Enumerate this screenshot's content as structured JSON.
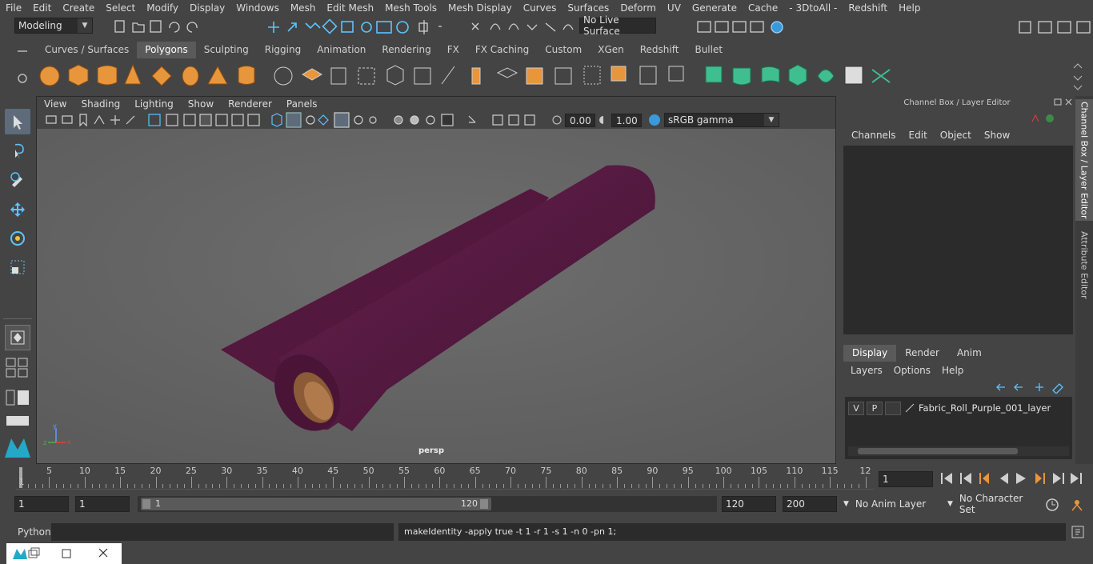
{
  "menubar": {
    "items": [
      "File",
      "Edit",
      "Create",
      "Select",
      "Modify",
      "Display",
      "Windows",
      "Mesh",
      "Edit Mesh",
      "Mesh Tools",
      "Mesh Display",
      "Curves",
      "Surfaces",
      "Deform",
      "UV",
      "Generate",
      "Cache",
      "- 3DtoAll -",
      "Redshift",
      "Help"
    ]
  },
  "statusline": {
    "mode": "Modeling",
    "live_surface": "No Live Surface"
  },
  "shelf": {
    "tabs": [
      "Curves / Surfaces",
      "Polygons",
      "Sculpting",
      "Rigging",
      "Animation",
      "Rendering",
      "FX",
      "FX Caching",
      "Custom",
      "XGen",
      "Redshift",
      "Bullet"
    ],
    "active_tab": "Polygons"
  },
  "panel": {
    "menu": [
      "View",
      "Shading",
      "Lighting",
      "Show",
      "Renderer",
      "Panels"
    ],
    "exposure": "0.00",
    "gamma": "1.00",
    "colorspace": "sRGB gamma",
    "camera_label": "persp"
  },
  "channelbox": {
    "title": "Channel Box / Layer Editor",
    "menu": [
      "Channels",
      "Edit",
      "Object",
      "Show"
    ]
  },
  "layereditor": {
    "tabs": [
      "Display",
      "Render",
      "Anim"
    ],
    "menu": [
      "Layers",
      "Options",
      "Help"
    ],
    "layers": [
      {
        "v": "V",
        "p": "P",
        "name": "Fabric_Roll_Purple_001_layer"
      }
    ]
  },
  "sidetabs": {
    "channel": "Channel Box / Layer Editor",
    "attribute": "Attribute Editor"
  },
  "timeline": {
    "ticks": [
      "5",
      "10",
      "15",
      "20",
      "25",
      "30",
      "35",
      "40",
      "45",
      "50",
      "55",
      "60",
      "65",
      "70",
      "75",
      "80",
      "85",
      "90",
      "95",
      "100",
      "105",
      "110",
      "115",
      "12"
    ],
    "start_marker": "1",
    "current_frame": "1"
  },
  "range": {
    "start": "1",
    "playback_start": "1",
    "slider_start": "1",
    "slider_end": "120",
    "playback_end": "120",
    "end": "200",
    "anim_layer": "No Anim Layer",
    "character_set": "No Character Set"
  },
  "cmdline": {
    "language": "Python",
    "result": "makeIdentity -apply true -t 1 -r 1 -s 1 -n 0 -pn 1;"
  },
  "colors": {
    "accent": "#5d6b7a",
    "fabric": "#5a1a43",
    "shelf_icon_orange": "#e8963c",
    "shelf_icon_green": "#3fbf8f"
  }
}
